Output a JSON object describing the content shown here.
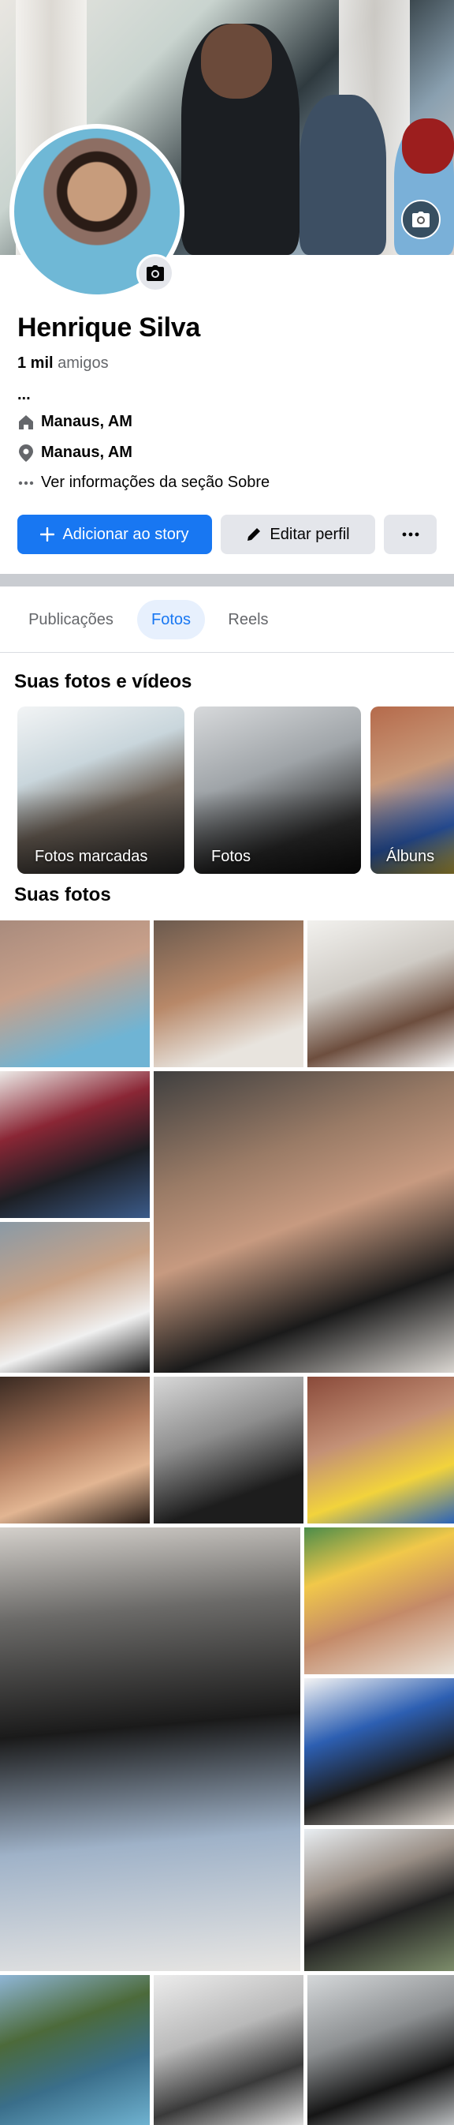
{
  "profile": {
    "name": "Henrique Silva",
    "friends_count": "1 mil",
    "friends_label": "amigos",
    "bio": "...",
    "hometown": "Manaus, AM",
    "current_city": "Manaus, AM",
    "about_link": "Ver informações da seção Sobre"
  },
  "actions": {
    "add_story": "Adicionar ao story",
    "edit_profile": "Editar perfil"
  },
  "tabs": [
    {
      "label": "Publicações",
      "active": false
    },
    {
      "label": "Fotos",
      "active": true
    },
    {
      "label": "Reels",
      "active": false
    }
  ],
  "sections": {
    "photos_videos_title": "Suas fotos e vídeos",
    "your_photos_title": "Suas fotos"
  },
  "albums": [
    {
      "label": "Fotos marcadas"
    },
    {
      "label": "Fotos"
    },
    {
      "label": "Álbuns"
    }
  ],
  "icons": {
    "cover_camera": "camera-icon",
    "avatar_camera": "camera-icon",
    "hometown": "house-icon",
    "location": "map-pin-icon",
    "about": "ellipsis-icon",
    "add": "plus-icon",
    "edit": "pencil-icon",
    "more": "ellipsis-icon"
  },
  "colors": {
    "primary": "#1877f2",
    "secondary_button": "#e4e6eb",
    "active_tab_bg": "#e7f0fd",
    "muted_text": "#65676b"
  }
}
